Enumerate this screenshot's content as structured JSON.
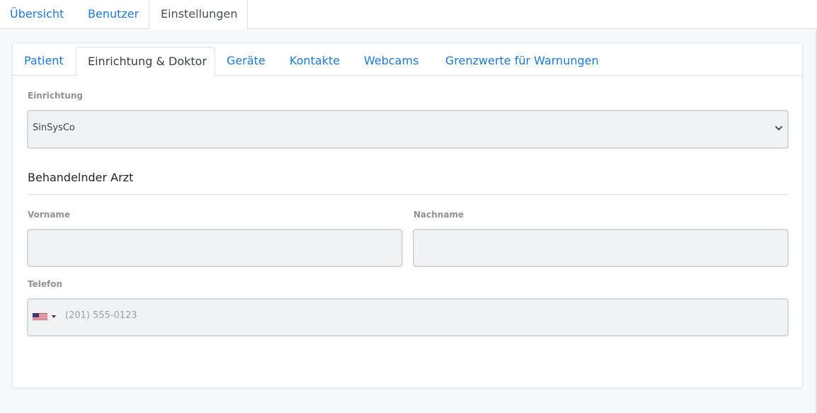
{
  "top_tabs": [
    {
      "label": "Übersicht",
      "active": false
    },
    {
      "label": "Benutzer",
      "active": false
    },
    {
      "label": "Einstellungen",
      "active": true
    }
  ],
  "sub_tabs": [
    {
      "label": "Patient",
      "active": false
    },
    {
      "label": "Einrichtung & Doktor",
      "active": true
    },
    {
      "label": "Geräte",
      "active": false
    },
    {
      "label": "Kontakte",
      "active": false
    },
    {
      "label": "Webcams",
      "active": false
    },
    {
      "label": "Grenzwerte für Warnungen",
      "active": false
    }
  ],
  "facility": {
    "label": "Einrichtung",
    "selected": "SinSysCo"
  },
  "doctor": {
    "section_title": "Behandelnder Arzt",
    "first_name_label": "Vorname",
    "first_name_value": "",
    "last_name_label": "Nachname",
    "last_name_value": "",
    "phone_label": "Telefon",
    "phone_placeholder": "(201) 555-0123",
    "phone_value": "",
    "country_icon": "us-flag-icon"
  },
  "colors": {
    "link": "#1b7ad6",
    "field_bg": "#f1f2f4",
    "field_border": "#d5d8dc",
    "label": "#8e9296"
  }
}
